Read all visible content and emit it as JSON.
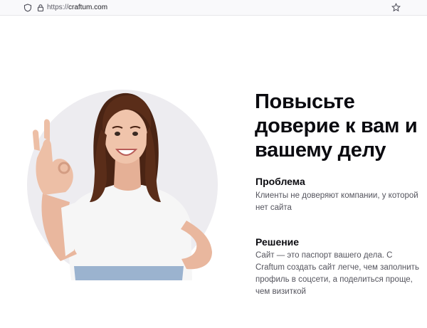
{
  "browser": {
    "url_scheme": "https://",
    "url_host": "craftum.com",
    "icons": {
      "shield": "shield-icon",
      "lock": "lock-icon",
      "bookmark": "star-icon"
    }
  },
  "hero": {
    "headline": "Повысьте доверие к вам и вашему делу",
    "problem": {
      "title": "Проблема",
      "text": "Клиенты не доверяют компании, у которой нет сайта"
    },
    "solution": {
      "title": "Решение",
      "text": "Сайт — это паспорт вашего дела. С Craftum создать сайт легче, чем заполнить профиль в соцсети, а поделиться проще, чем визиткой"
    }
  },
  "colors": {
    "heading": "#0b0b10",
    "body_text": "#55555e",
    "circle_bg": "#edecf0"
  }
}
